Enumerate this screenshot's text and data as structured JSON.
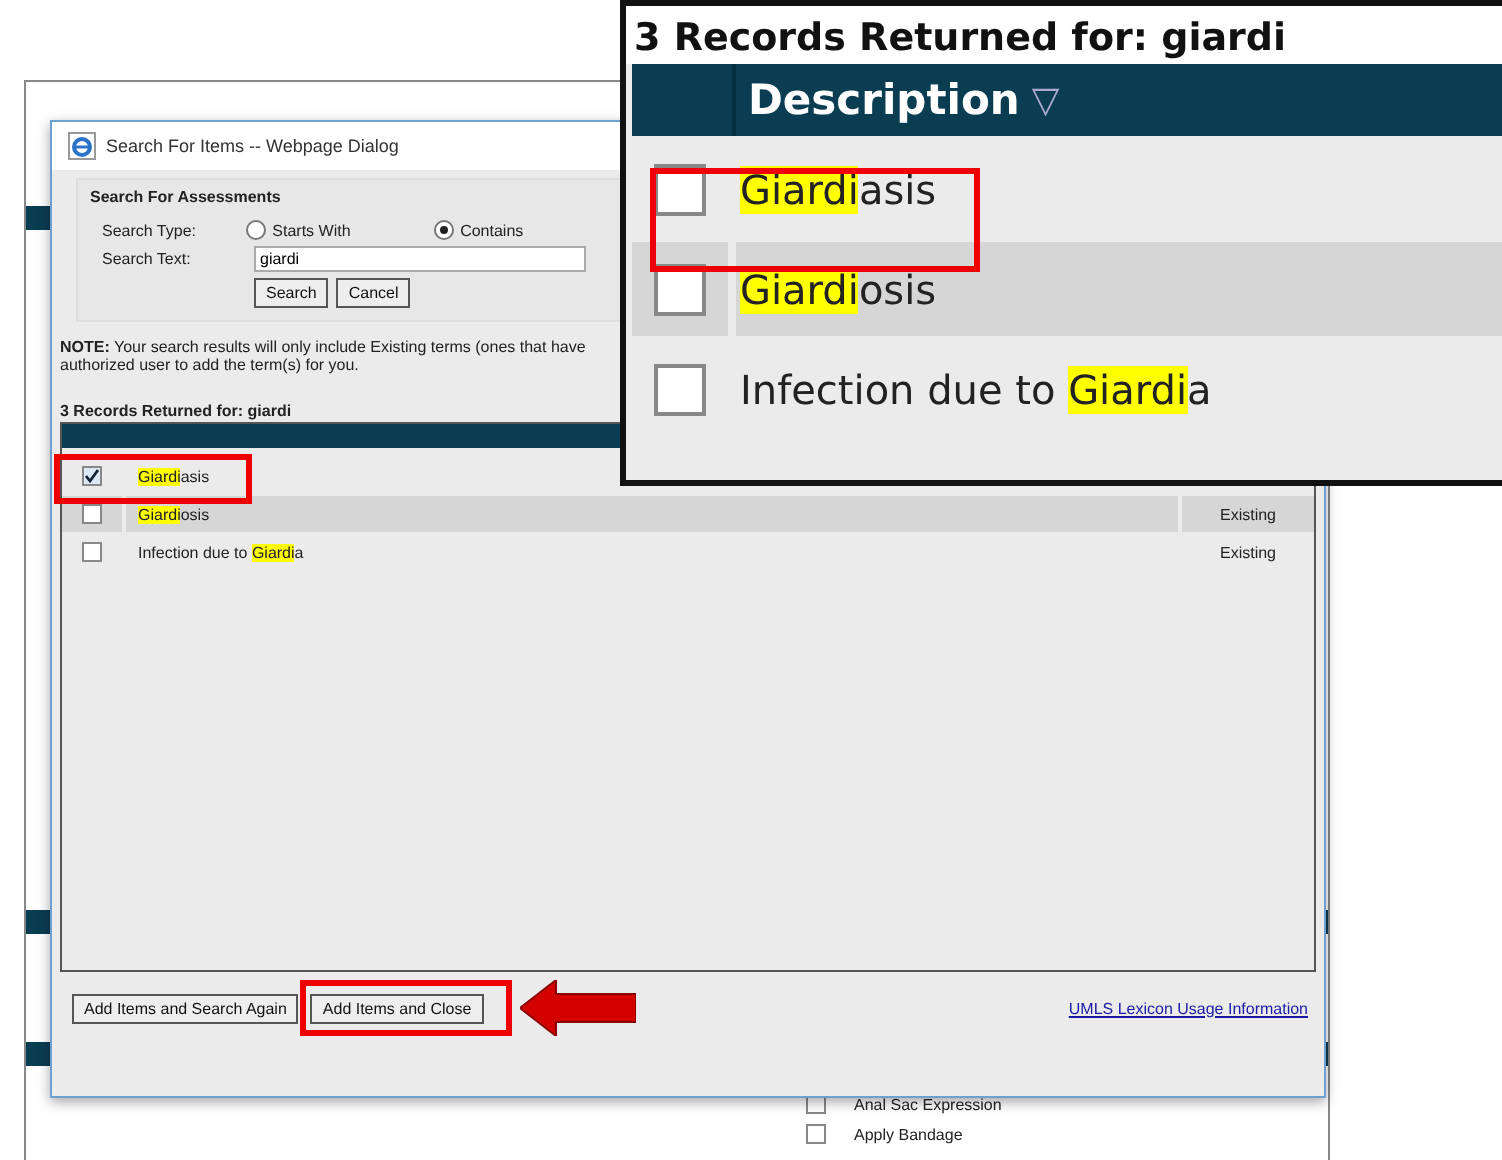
{
  "background_app": {
    "list_items": [
      {
        "label": "Anal Sac Expression",
        "checked": false
      },
      {
        "label": "Apply Bandage",
        "checked": false
      }
    ]
  },
  "dialog": {
    "title": "Search For Items -- Webpage Dialog",
    "group_title": "Search For Assessments",
    "search_type_label": "Search Type:",
    "search_types": [
      {
        "label": "Starts With",
        "selected": false
      },
      {
        "label": "Contains",
        "selected": true
      }
    ],
    "search_text_label": "Search Text:",
    "search_text": "giardi",
    "buttons": [
      "Search",
      "Cancel"
    ],
    "note_lines": [
      "**NOTE:** Your search results will only include Existing terms (ones that have",
      "authorized user to add the term(s) for you."
    ],
    "results_title": "3 Records Returned for: giardi",
    "rows": [
      {
        "checked": true,
        "shaded": false,
        "segments": [
          {
            "text": "Giardi",
            "highlight": true
          },
          {
            "text": "asis",
            "highlight": false
          }
        ]
      },
      {
        "checked": false,
        "shaded": true,
        "status": "Existing",
        "segments": [
          {
            "text": "Giardi",
            "highlight": true
          },
          {
            "text": "osis",
            "highlight": false
          }
        ]
      },
      {
        "checked": false,
        "shaded": false,
        "status": "Existing",
        "segments": [
          {
            "text": "Infection due to ",
            "highlight": false
          },
          {
            "text": "Giardi",
            "highlight": true
          },
          {
            "text": "a",
            "highlight": false
          }
        ]
      }
    ],
    "footer_buttons": [
      "Add Items and Search Again",
      "Add Items and Close"
    ],
    "link": "UMLS Lexicon Usage Information"
  },
  "zoom_inset": {
    "title": "3 Records Returned for: giardi",
    "column": "Description",
    "sort_icon": "▽",
    "rows": [
      {
        "checked": false,
        "shaded": false,
        "segments": [
          {
            "text": "Giardi",
            "highlight": true
          },
          {
            "text": "asis",
            "highlight": false
          }
        ]
      },
      {
        "checked": false,
        "shaded": true,
        "segments": [
          {
            "text": "Giardi",
            "highlight": true
          },
          {
            "text": "osis",
            "highlight": false
          }
        ]
      },
      {
        "checked": false,
        "shaded": false,
        "segments": [
          {
            "text": "Infection due to ",
            "highlight": false
          },
          {
            "text": "Giardi",
            "highlight": true
          },
          {
            "text": "a",
            "highlight": false
          }
        ]
      }
    ]
  }
}
